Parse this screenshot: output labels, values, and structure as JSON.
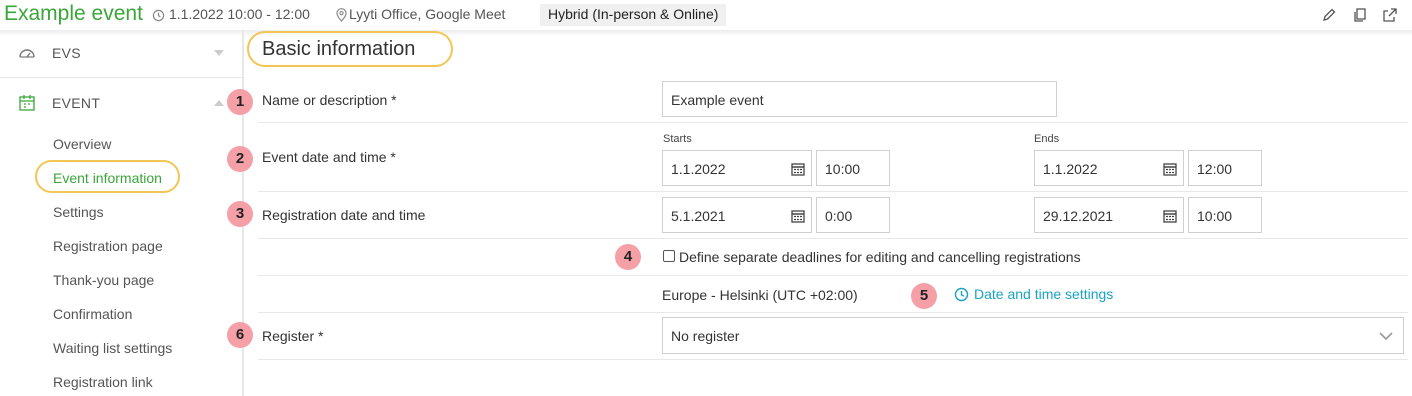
{
  "header": {
    "title": "Example event",
    "datetime": "1.1.2022 10:00 - 12:00",
    "location": "Lyyti Office, Google Meet",
    "badge": "Hybrid (In-person & Online)",
    "icons": [
      "pencil-icon",
      "copy-icon",
      "external-link-icon"
    ]
  },
  "sidebar": {
    "sections": [
      {
        "label": "EVS",
        "icon": "dashboard-icon"
      },
      {
        "label": "EVENT",
        "icon": "calendar-icon"
      }
    ],
    "items": [
      {
        "label": "Overview"
      },
      {
        "label": "Event information"
      },
      {
        "label": "Settings"
      },
      {
        "label": "Registration page"
      },
      {
        "label": "Thank-you page"
      },
      {
        "label": "Confirmation"
      },
      {
        "label": "Waiting list settings"
      },
      {
        "label": "Registration link"
      }
    ],
    "active_item": "Event information"
  },
  "main": {
    "section_title": "Basic information",
    "markers": [
      "1",
      "2",
      "3",
      "4",
      "5",
      "6"
    ],
    "name": {
      "label": "Name or description *",
      "value": "Example event"
    },
    "event_dt": {
      "label": "Event date and time *",
      "starts_label": "Starts",
      "ends_label": "Ends",
      "start_date": "1.1.2022",
      "start_time": "10:00",
      "end_date": "1.1.2022",
      "end_time": "12:00"
    },
    "registration_dt": {
      "label": "Registration date and time",
      "start_date": "5.1.2021",
      "start_time": "0:00",
      "end_date": "29.12.2021",
      "end_time": "10:00"
    },
    "separate_deadlines": {
      "label": "Define separate deadlines for editing and cancelling registrations",
      "checked": false
    },
    "timezone": "Europe - Helsinki (UTC +02:00)",
    "dt_settings_link": "Date and time settings",
    "register": {
      "label": "Register *",
      "value": "No register"
    }
  },
  "colors": {
    "accent_green": "#3aa63a",
    "highlight_yellow": "#f2c654",
    "marker_pink": "#f4a0a6",
    "link_blue": "#19a3c4"
  }
}
